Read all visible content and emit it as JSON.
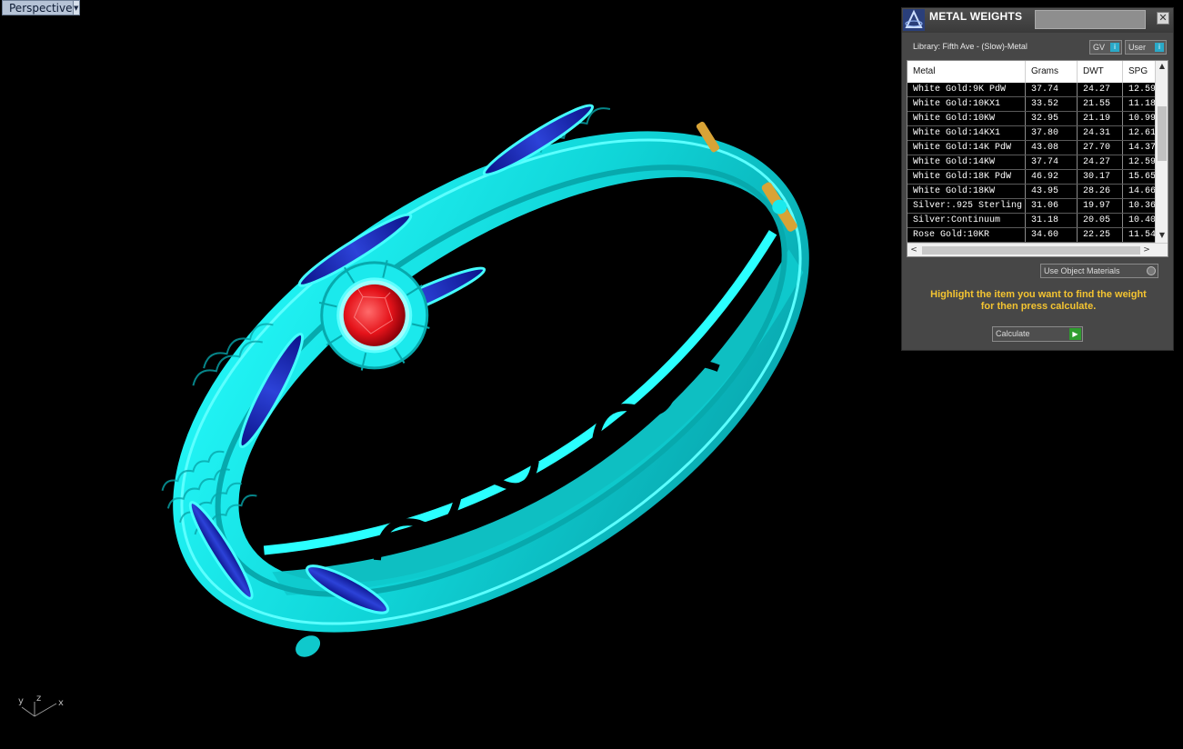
{
  "viewport": {
    "label": "Perspective",
    "axis_labels": {
      "y": "y",
      "z": "z",
      "x": "x"
    }
  },
  "panel": {
    "title": "METAL WEIGHTS",
    "library_label": "Library: Fifth Ave - (Slow)-Metal",
    "toggle_gv": "GV",
    "toggle_user": "User",
    "columns": [
      "Metal",
      "Grams",
      "DWT",
      "SPG"
    ],
    "rows": [
      [
        "White Gold:9K PdW",
        "37.74",
        "24.27",
        "12.59"
      ],
      [
        "White Gold:10KX1",
        "33.52",
        "21.55",
        "11.18"
      ],
      [
        "White Gold:10KW",
        "32.95",
        "21.19",
        "10.99"
      ],
      [
        "White Gold:14KX1",
        "37.80",
        "24.31",
        "12.61"
      ],
      [
        "White Gold:14K PdW",
        "43.08",
        "27.70",
        "14.37"
      ],
      [
        "White Gold:14KW",
        "37.74",
        "24.27",
        "12.59"
      ],
      [
        "White Gold:18K PdW",
        "46.92",
        "30.17",
        "15.65"
      ],
      [
        "White Gold:18KW",
        "43.95",
        "28.26",
        "14.66"
      ],
      [
        "Silver:.925 Sterling",
        "31.06",
        "19.97",
        "10.36"
      ],
      [
        "Silver:Continuum",
        "31.18",
        "20.05",
        "10.40"
      ],
      [
        "Rose Gold:10KR",
        "34.60",
        "22.25",
        "11.54"
      ]
    ],
    "use_object_materials": "Use Object Materials",
    "instructions_line1": "Highlight the item you want to find the weight",
    "instructions_line2": "for then press calculate.",
    "calculate_label": "Calculate"
  },
  "colors": {
    "model": "#12e6e6",
    "gem": "#e5131a",
    "enamel": "#1a2aa8",
    "hinge": "#d8a336",
    "instructions": "#f4c431"
  }
}
